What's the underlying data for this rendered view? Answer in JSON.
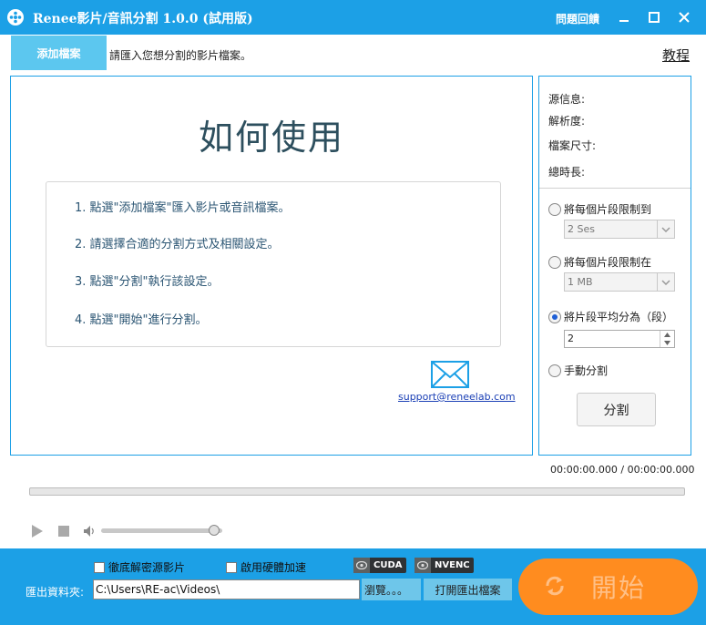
{
  "window": {
    "title": "Renee影片/音訊分割 1.0.0 (試用版)",
    "feedback": "問題回饋"
  },
  "toolbar": {
    "add_file": "添加檔案",
    "hint": "請匯入您想分割的影片檔案。",
    "tutorial": "教程"
  },
  "howto": {
    "title": "如何使用",
    "steps": [
      "1. 點選\"添加檔案\"匯入影片或音訊檔案。",
      "2. 請選擇合適的分割方式及相關設定。",
      "3. 點選\"分割\"執行該設定。",
      "4. 點選\"開始\"進行分割。"
    ],
    "support_email": "support@reneelab.com"
  },
  "source_info": {
    "source": "源信息:",
    "resolution": "解析度:",
    "file_size": "檔案尺寸:",
    "duration": "總時長:"
  },
  "split_options": {
    "by_duration": {
      "label": "將每個片段限制到",
      "value": "2 Ses",
      "selected": false
    },
    "by_size": {
      "label": "將每個片段限制在",
      "value": "1 MB",
      "selected": false
    },
    "by_count": {
      "label": "將片段平均分為（段）",
      "value": "2",
      "selected": true
    },
    "manual": {
      "label": "手動分割",
      "selected": false
    },
    "split_button": "分割"
  },
  "player": {
    "timecode": "00:00:00.000 / 00:00:00.000",
    "volume_level": 0.93
  },
  "bottom": {
    "decrypt_source": "徹底解密源影片",
    "hw_accel": "啟用硬體加速",
    "cuda": "CUDA",
    "nvenc": "NVENC",
    "output_label": "匯出資料夾:",
    "output_path": "C:\\Users\\RE-ac\\Videos\\",
    "browse": "瀏覽。。。",
    "open_folder": "打開匯出檔案",
    "start": "開始"
  },
  "colors": {
    "accent": "#1ca0e6",
    "start": "#ff8c1f",
    "add_file": "#5cc7ef"
  }
}
